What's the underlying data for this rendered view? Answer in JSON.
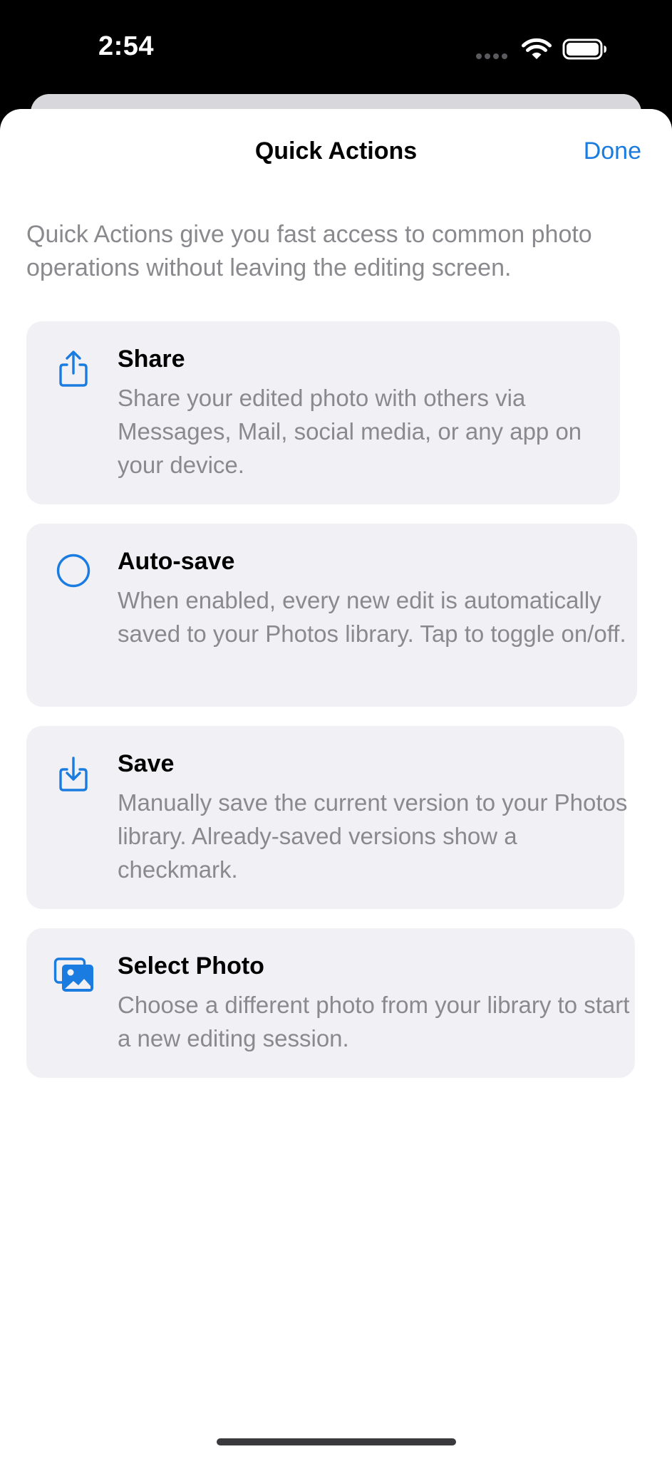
{
  "status_bar": {
    "time": "2:54"
  },
  "sheet": {
    "title": "Quick Actions",
    "done_label": "Done",
    "intro": "Quick Actions give you fast access to common photo operations without leaving the editing screen."
  },
  "actions": [
    {
      "title": "Share",
      "description": "Share your edited photo with others via Messages, Mail, social media, or any app on your device.",
      "icon": "share-icon"
    },
    {
      "title": "Auto-save",
      "description": "When enabled, every new edit is automatically saved to your Photos library. Tap to toggle on/off.",
      "icon": "circle-toggle-icon"
    },
    {
      "title": "Save",
      "description": "Manually save the current version to your Photos library. Already-saved versions show a checkmark.",
      "icon": "save-download-icon"
    },
    {
      "title": "Select Photo",
      "description": "Choose a different photo from your library to start a new editing session.",
      "icon": "photo-library-icon"
    }
  ],
  "colors": {
    "accent": "#1a7ce0",
    "card_background": "#f1f1f5",
    "secondary_text": "#8a8a8e"
  }
}
